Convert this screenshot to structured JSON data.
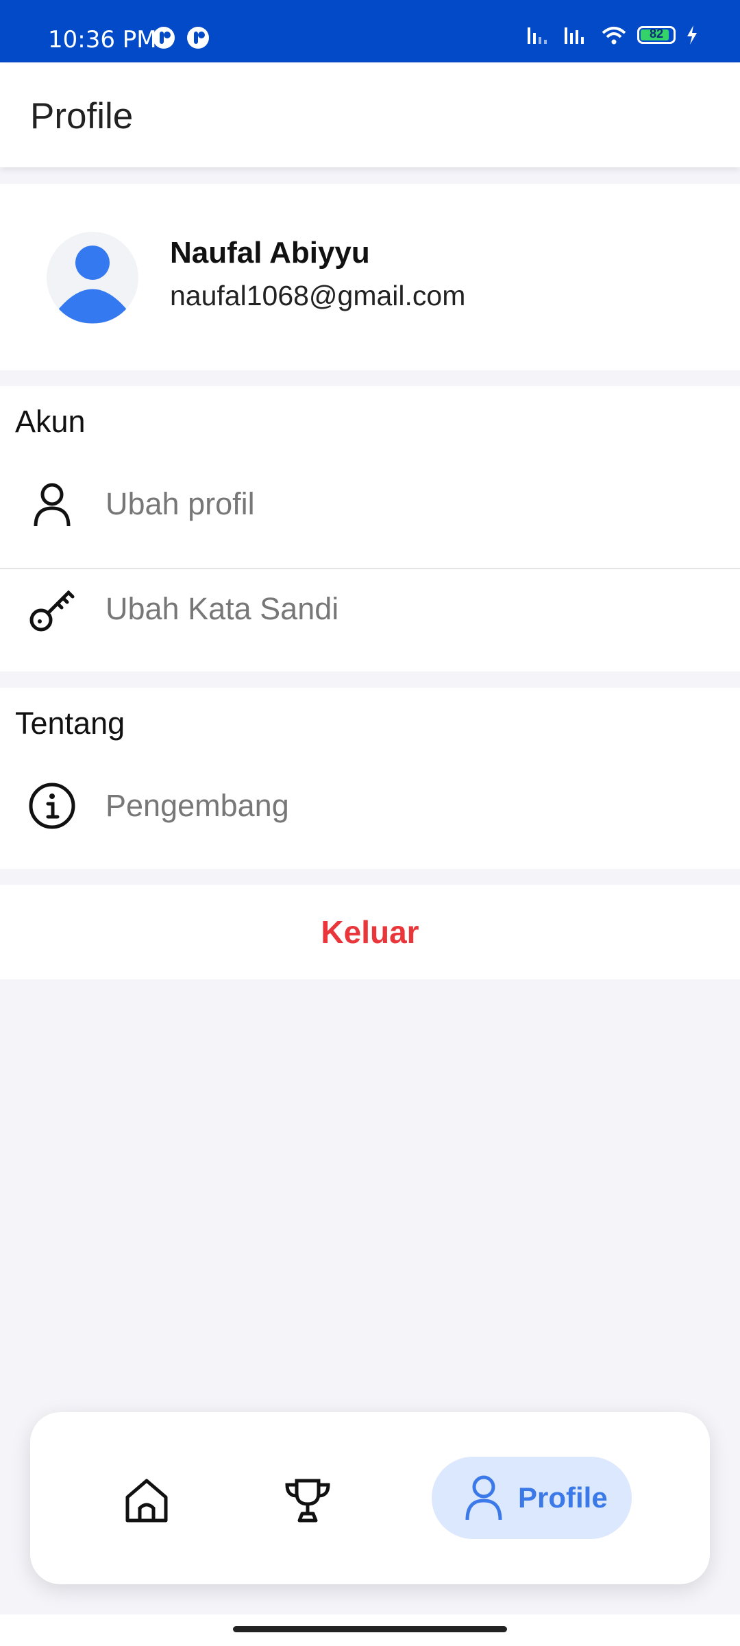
{
  "status_bar": {
    "time": "10:36 PM",
    "battery_level": "82",
    "icons": [
      "notification-app-icon",
      "notification-app-icon",
      "signal-icon",
      "signal-icon",
      "wifi-icon",
      "battery-icon",
      "charging-icon"
    ]
  },
  "app_bar": {
    "title": "Profile"
  },
  "profile": {
    "name": "Naufal Abiyyu",
    "email": "naufal1068@gmail.com"
  },
  "sections": {
    "akun": {
      "title": "Akun",
      "items": [
        {
          "label": "Ubah profil",
          "icon": "user-icon"
        },
        {
          "label": "Ubah Kata Sandi",
          "icon": "key-icon"
        }
      ]
    },
    "tentang": {
      "title": "Tentang",
      "items": [
        {
          "label": "Pengembang",
          "icon": "info-icon"
        }
      ]
    }
  },
  "logout": {
    "label": "Keluar"
  },
  "bottom_nav": {
    "items": [
      {
        "icon": "home-icon"
      },
      {
        "icon": "trophy-icon"
      },
      {
        "icon": "user-icon",
        "label": "Profile",
        "active": true
      }
    ]
  },
  "colors": {
    "status_bar": "#024ac7",
    "accent": "#3a79e7",
    "logout": "#e8363a",
    "background": "#f4f4f9"
  }
}
